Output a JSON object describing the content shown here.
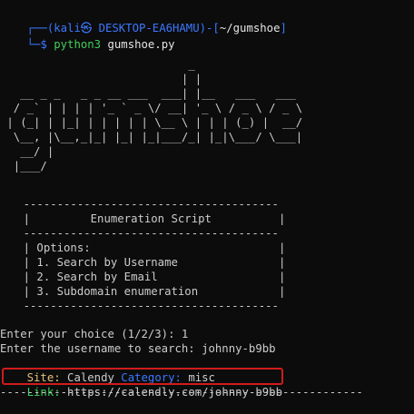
{
  "prompt": {
    "corner_top": "┌──(",
    "user": "kali㉿ DESKTOP-EA6HAMU",
    "sep": ")-[",
    "path": "~/gumshoe",
    "close": "]",
    "corner_bottom": "└─",
    "dollar": "$",
    "command_name": "python3",
    "command_args": " gumshoe.py"
  },
  "banner_art": "                            _\n                           | |\n   __ _ _   _ _ __ ___  ___| |__   ___   ___\n  / _` | | | | '_ ` _ \\/ __| '_ \\ / _ \\ / _ \\\n | (_| | |_| | | | | | \\__ \\ | | | (_) |  __/\n  \\__, |\\__,_|_| |_| |_|___/_| |_|\\___/ \\___|\n   __/ |\n  |___/",
  "menu_box": "    --------------------------------------\n    |         Enumeration Script          |\n    --------------------------------------\n    | Options:                            |\n    | 1. Search by Username               |\n    | 2. Search by Email                  |\n    | 3. Subdomain enumeration            |\n    --------------------------------------",
  "output": {
    "choice_line": "Enter your choice (1/2/3): 1",
    "username_line": "Enter the username to search: johnny-b9bb",
    "site_label": "Site:",
    "site_value": " Calendy ",
    "category_label": "Category:",
    "category_value": " misc",
    "link_label": "Link:",
    "link_value": " https://calendly.com/johnny-b9bb",
    "divider": "------------------------------------------------------"
  },
  "colors": {
    "background": "#0c0c0c",
    "prompt_blue": "#3b78ff",
    "command_green": "#3fd05a",
    "site_yellow": "#e5c07b",
    "highlight_red": "#d01c1c"
  }
}
